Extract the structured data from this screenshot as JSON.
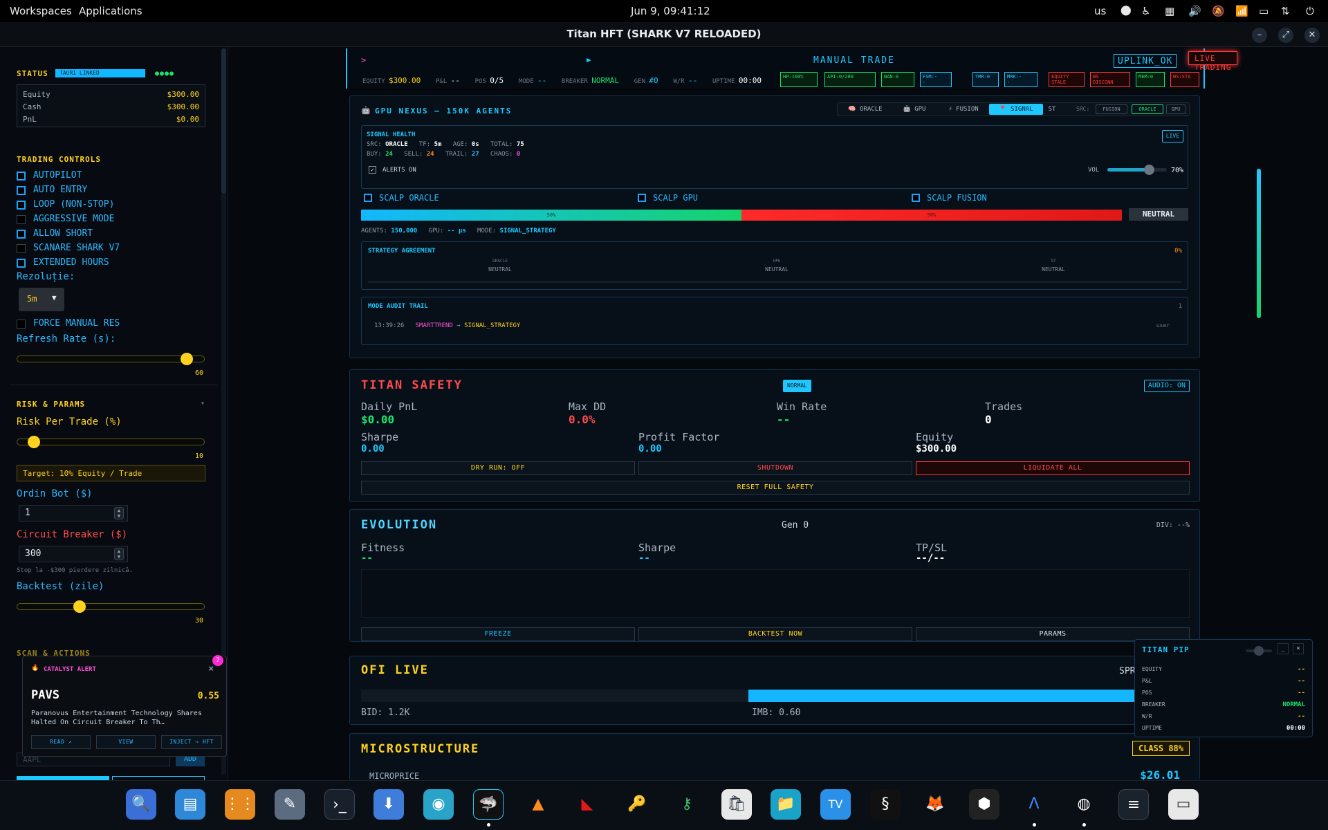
{
  "topbar": {
    "workspaces": "Workspaces",
    "applications": "Applications",
    "clock": "Jun 9, 09:41:12",
    "kb": "us"
  },
  "window": {
    "title": "Titan HFT (SHARK V7 RELOADED)"
  },
  "sidebar": {
    "status_title": "STATUS",
    "tauri": "TAURI LINKED",
    "equity_label": "Equity",
    "equity": "$300.00",
    "cash_label": "Cash",
    "cash": "$300.00",
    "pnl_label": "PnL",
    "pnl": "$0.00",
    "controls_title": "TRADING CONTROLS",
    "controls": [
      {
        "label": "AUTOPILOT",
        "checked": true
      },
      {
        "label": "AUTO ENTRY",
        "checked": true
      },
      {
        "label": "LOOP (NON-STOP)",
        "checked": true
      },
      {
        "label": "AGGRESSIVE MODE",
        "checked": false
      },
      {
        "label": "ALLOW SHORT",
        "checked": true
      },
      {
        "label": "SCANARE SHARK V7",
        "checked": false
      },
      {
        "label": "EXTENDED HOURS",
        "checked": true
      }
    ],
    "rez_label": "Rezoluție:",
    "rez_value": "5m",
    "force_manual": "FORCE MANUAL RES",
    "refresh_label": "Refresh Rate (s):",
    "refresh_value": "60",
    "refresh_frac": 0.93,
    "risk_title": "RISK & PARAMS",
    "risk_arrow": "▾",
    "risk_label": "Risk Per Trade (%)",
    "risk_value": "10",
    "risk_frac": 0.06,
    "target": "Target: 10% Equity / Trade",
    "ordin_label": "Ordin Bot ($)",
    "ordin_value": "1",
    "cb_label": "Circuit Breaker ($)",
    "cb_value": "300",
    "cb_note": "Stop la -$300 pierdere zilnică.",
    "backtest_label": "Backtest (zile)",
    "backtest_value": "30",
    "backtest_frac": 0.32,
    "scan_title": "SCAN & ACTIONS",
    "ticker_placeholder": "AAPL",
    "add_label": "ADD"
  },
  "catalyst": {
    "title": "CATALYST ALERT",
    "badge": "7",
    "ticker": "PAVS",
    "score": "0.55",
    "headline": "Paranovus Entertainment Technology Shares Halted On Circuit Breaker To Th…",
    "read": "READ ↗",
    "view": "VIEW",
    "inject": "INJECT → HFT",
    "close": "×"
  },
  "header": {
    "prompt": ">",
    "play": "▶",
    "manual": "MANUAL TRADE",
    "uplink": "UPLINK_OK",
    "live": "LIVE TRADING",
    "equity_l": "EQUITY",
    "equity_v": "$300.00",
    "pnl_l": "P&L",
    "pnl_v": "--",
    "pos_l": "POS",
    "pos_v": "0/5",
    "mode_l": "MODE",
    "mode_v": "--",
    "breaker_l": "BREAKER",
    "breaker_v": "NORMAL",
    "gen_l": "GEN",
    "gen_v": "#0",
    "wr_l": "W/R",
    "wr_v": "--",
    "uptime_l": "UPTIME",
    "uptime_v": "00:00",
    "chips": [
      "HP:100%",
      "API:0/200",
      "NAN:0",
      "FSM:-\n-",
      "TMR:0",
      "MRK:-\n-",
      "EQUITY\nSTALE",
      "WS\nDISCONN",
      "MEM:0",
      "WS:STA"
    ]
  },
  "nexus": {
    "title": "GPU NEXUS — 150K AGENTS",
    "tabs": [
      "ORACLE",
      "GPU",
      "FUSION",
      "SIGNAL",
      "ST"
    ],
    "src_label": "SRC:",
    "src_opts": [
      "FUSION",
      "ORACLE",
      "GPU"
    ],
    "health_title": "SIGNAL HEALTH",
    "live": "LIVE",
    "src_v": "ORACLE",
    "tf_v": "5m",
    "age_v": "0s",
    "total_v": "75",
    "buy_v": "24",
    "sell_v": "24",
    "trail_v": "27",
    "chaos_v": "0",
    "k_src": "SRC:",
    "k_tf": "TF:",
    "k_age": "AGE:",
    "k_total": "TOTAL:",
    "k_buy": "BUY:",
    "k_sell": "SELL:",
    "k_trail": "TRAIL:",
    "k_chaos": "CHAOS:",
    "alerts": "ALERTS ON",
    "vol_label": "VOL",
    "vol_value": "70%",
    "vol_frac": 0.7,
    "scalp": [
      "SCALP ORACLE",
      "SCALP GPU",
      "SCALP FUSION"
    ],
    "bar_left": "50%",
    "bar_right": "50%",
    "bar_frac": 0.5,
    "neutral": "NEUTRAL",
    "agents_l": "AGENTS:",
    "agents_v": "150,000",
    "gpu_l": "GPU:",
    "gpu_v": "-- µs",
    "mode_l": "MODE:",
    "mode_v": "SIGNAL_STRATEGY",
    "agree_title": "STRATEGY AGREEMENT",
    "agree_pct": "0%",
    "agree": [
      {
        "name": "ORACLE",
        "v": "NEUTRAL"
      },
      {
        "name": "GPU",
        "v": "NEUTRAL"
      },
      {
        "name": "ST",
        "v": "NEUTRAL"
      }
    ],
    "audit_title": "MODE AUDIT TRAIL",
    "audit_count": "1",
    "audit_time": "13:39:26",
    "audit_from": "SMARTTREND",
    "audit_arrow": "→",
    "audit_to": "SIGNAL_STRATEGY",
    "audit_user": "user"
  },
  "safety": {
    "title": "TITAN SAFETY",
    "state": "NORMAL",
    "audio": "AUDIO: ON",
    "daily_l": "Daily PnL",
    "daily_v": "$0.00",
    "maxdd_l": "Max DD",
    "maxdd_v": "0.0%",
    "wr_l": "Win Rate",
    "wr_v": "--",
    "trades_l": "Trades",
    "trades_v": "0",
    "sharpe_l": "Sharpe",
    "sharpe_v": "0.00",
    "pf_l": "Profit Factor",
    "pf_v": "0.00",
    "eq_l": "Equity",
    "eq_v": "$300.00",
    "dry": "DRY RUN: OFF",
    "shutdown": "SHUTDOWN",
    "liquidate": "LIQUIDATE ALL",
    "reset": "RESET FULL SAFETY"
  },
  "evolution": {
    "title": "EVOLUTION",
    "gen": "Gen 0",
    "div": "DIV: --%",
    "fit_l": "Fitness",
    "fit_v": "--",
    "sh_l": "Sharpe",
    "sh_v": "--",
    "tp_l": "TP/SL",
    "tp_v": "--/--",
    "freeze": "FREEZE",
    "backtest": "BACKTEST NOW",
    "params": "PARAMS"
  },
  "ofi": {
    "title": "OFI LIVE",
    "spr": "SPR",
    "bid": "BID: 1.2K",
    "imb": "IMB: 0.60",
    "fill_start": 0.5
  },
  "micro": {
    "title": "MICROSTRUCTURE",
    "class": "CLASS 88%",
    "mp_l": "MICROPRICE",
    "mp_v": "$26.01"
  },
  "pip": {
    "title": "TITAN PIP",
    "min": "_",
    "close": "×",
    "rows": [
      {
        "k": "EQUITY",
        "v": "--"
      },
      {
        "k": "P&L",
        "v": "--"
      },
      {
        "k": "POS",
        "v": "--"
      },
      {
        "k": "BREAKER",
        "v": "NORMAL"
      },
      {
        "k": "W/R",
        "v": "--"
      },
      {
        "k": "UPTIME",
        "v": "00:00"
      }
    ]
  },
  "colors": {
    "accent": "#1ec8ff",
    "yellow": "#ffd21f",
    "red": "#ff3b3b",
    "green": "#19e36b"
  }
}
